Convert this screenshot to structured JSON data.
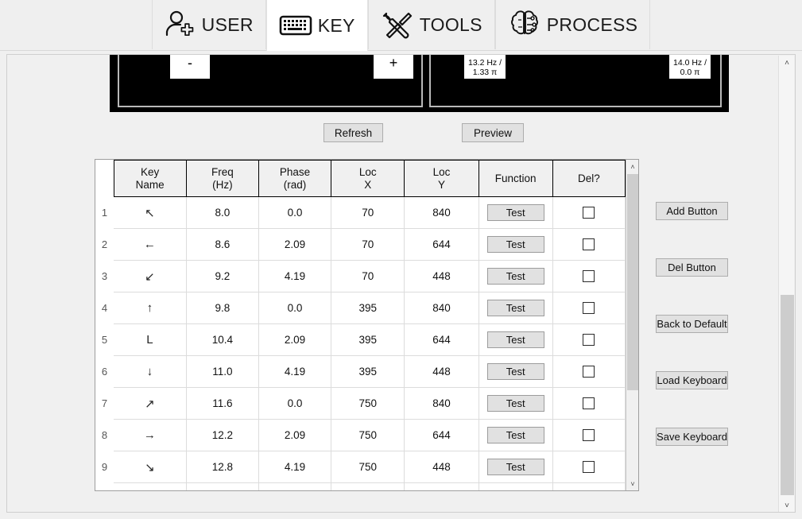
{
  "tabs": [
    {
      "id": "user",
      "label": "USER",
      "icon": "user-add-icon",
      "active": false
    },
    {
      "id": "key",
      "label": "KEY",
      "icon": "keyboard-icon",
      "active": true
    },
    {
      "id": "tools",
      "label": "TOOLS",
      "icon": "tools-icon",
      "active": false
    },
    {
      "id": "process",
      "label": "PROCESS",
      "icon": "brain-icon",
      "active": false
    }
  ],
  "preview_strip": {
    "keys": [
      {
        "glyph": "-",
        "sub": ""
      },
      {
        "glyph": "+",
        "sub": ""
      },
      {
        "glyph": "",
        "sub": "13.2 Hz /",
        "sub2": "1.33 π"
      },
      {
        "glyph": "",
        "sub": "14.0 Hz /",
        "sub2": "0.0 π"
      }
    ]
  },
  "toolbar": {
    "refresh_label": "Refresh",
    "preview_label": "Preview"
  },
  "table": {
    "headers": [
      {
        "line1": "Key",
        "line2": "Name"
      },
      {
        "line1": "Freq",
        "line2": "(Hz)"
      },
      {
        "line1": "Phase",
        "line2": "(rad)"
      },
      {
        "line1": "Loc",
        "line2": "X"
      },
      {
        "line1": "Loc",
        "line2": "Y"
      },
      {
        "line1": "Function",
        "line2": ""
      },
      {
        "line1": "Del?",
        "line2": ""
      }
    ],
    "function_button_label": "Test",
    "rows": [
      {
        "num": "1",
        "key_name": "↖",
        "freq": "8.0",
        "phase": "0.0",
        "loc_x": "70",
        "loc_y": "840",
        "function": "Test",
        "del_checked": false
      },
      {
        "num": "2",
        "key_name": "←",
        "freq": "8.6",
        "phase": "2.09",
        "loc_x": "70",
        "loc_y": "644",
        "function": "Test",
        "del_checked": false
      },
      {
        "num": "3",
        "key_name": "↙",
        "freq": "9.2",
        "phase": "4.19",
        "loc_x": "70",
        "loc_y": "448",
        "function": "Test",
        "del_checked": false
      },
      {
        "num": "4",
        "key_name": "↑",
        "freq": "9.8",
        "phase": "0.0",
        "loc_x": "395",
        "loc_y": "840",
        "function": "Test",
        "del_checked": false
      },
      {
        "num": "5",
        "key_name": "L",
        "freq": "10.4",
        "phase": "2.09",
        "loc_x": "395",
        "loc_y": "644",
        "function": "Test",
        "del_checked": false
      },
      {
        "num": "6",
        "key_name": "↓",
        "freq": "11.0",
        "phase": "4.19",
        "loc_x": "395",
        "loc_y": "448",
        "function": "Test",
        "del_checked": false
      },
      {
        "num": "7",
        "key_name": "↗",
        "freq": "11.6",
        "phase": "0.0",
        "loc_x": "750",
        "loc_y": "840",
        "function": "Test",
        "del_checked": false
      },
      {
        "num": "8",
        "key_name": "→",
        "freq": "12.2",
        "phase": "2.09",
        "loc_x": "750",
        "loc_y": "644",
        "function": "Test",
        "del_checked": false
      },
      {
        "num": "9",
        "key_name": "↘",
        "freq": "12.8",
        "phase": "4.19",
        "loc_x": "750",
        "loc_y": "448",
        "function": "Test",
        "del_checked": false
      }
    ]
  },
  "side_buttons": [
    {
      "id": "add",
      "label": "Add Button"
    },
    {
      "id": "del",
      "label": "Del Button"
    },
    {
      "id": "default",
      "label": "Back to Default"
    },
    {
      "id": "load",
      "label": "Load Keyboard"
    },
    {
      "id": "save",
      "label": "Save Keyboard"
    }
  ],
  "scrollbars": {
    "up_arrow": "˄",
    "down_arrow": "˅"
  },
  "colors": {
    "window_bg": "#f0f0f0",
    "tab_active_bg": "#ffffff",
    "tab_inactive_bg": "#efefef",
    "preview_bg": "#000000",
    "button_face": "#e1e1e1",
    "scroll_thumb": "#cdcdcd",
    "grid_line": "#dcdcdc",
    "header_border": "#000000"
  }
}
